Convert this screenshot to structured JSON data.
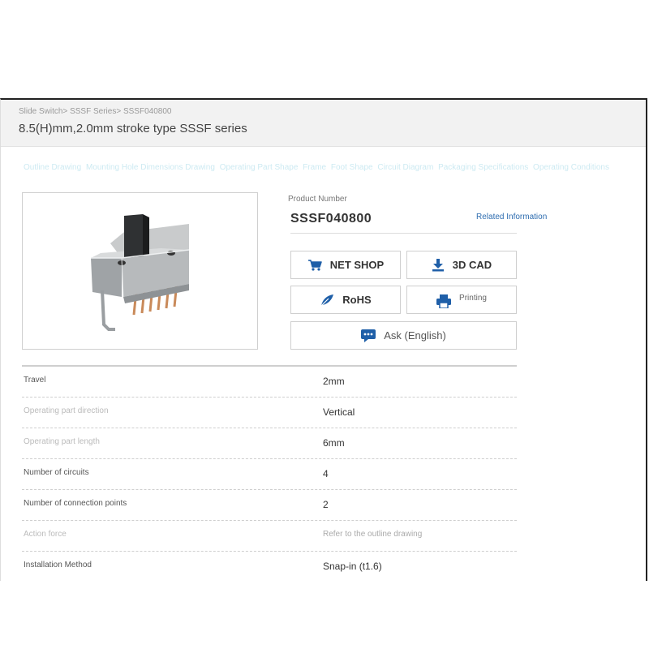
{
  "breadcrumb": [
    "Slide Switch",
    "SSSF Series",
    "SSSF040800"
  ],
  "page_title": "8.5(H)mm,2.0mm stroke type SSSF series",
  "nav_links": [
    "Outline Drawing",
    "Mounting Hole Dimensions Drawing",
    "Operating Part Shape",
    "Frame",
    "Foot Shape",
    "Circuit Diagram",
    "Packaging Specifications",
    "Operating Conditions"
  ],
  "product": {
    "number_label": "Product Number",
    "number": "SSSF040800",
    "related_label": "Related Information"
  },
  "buttons": {
    "net_shop": "NET SHOP",
    "cad": "3D CAD",
    "rohs": "RoHS",
    "printing": "Printing",
    "ask": "Ask (English)"
  },
  "icons": {
    "net_shop": "cart-icon",
    "cad": "download-icon",
    "rohs": "leaf-icon",
    "printing": "printer-icon",
    "ask": "chat-icon"
  },
  "colors": {
    "accent": "#1f5fa8",
    "link": "#2e6db0",
    "nav_link": "#cdeaf2"
  },
  "specs": [
    {
      "label": "Travel",
      "value": "2mm"
    },
    {
      "label": "Operating part direction",
      "value": "Vertical"
    },
    {
      "label": "Operating part length",
      "value": "6mm"
    },
    {
      "label": "Number of circuits",
      "value": "4"
    },
    {
      "label": "Number of connection points",
      "value": "2"
    },
    {
      "label": "Action force",
      "value": "Refer to the outline drawing"
    },
    {
      "label": "Installation Method",
      "value": "Snap-in (t1.6)"
    }
  ]
}
